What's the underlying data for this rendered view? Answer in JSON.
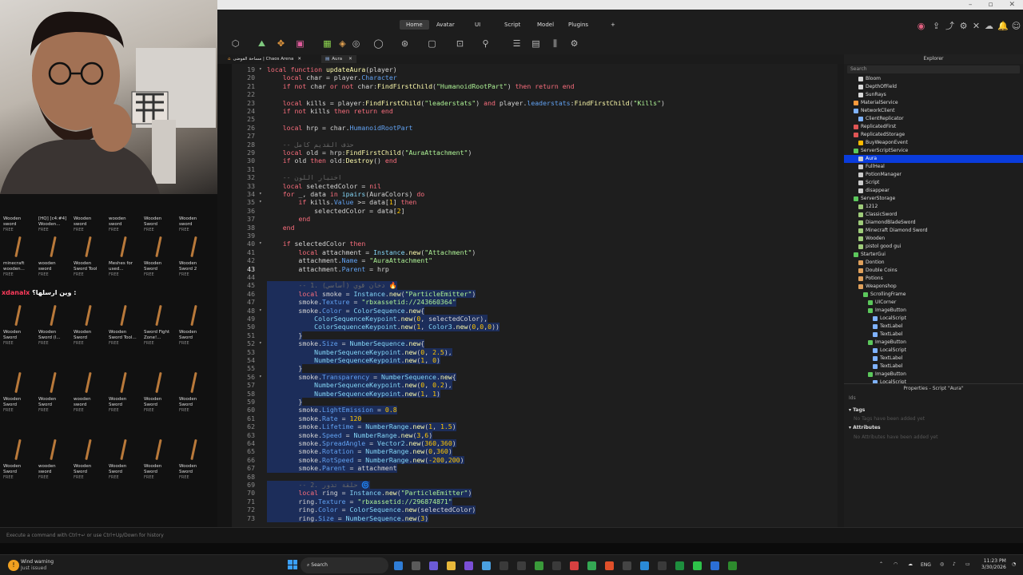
{
  "ribbon": {
    "tabs": [
      "Home",
      "Avatar",
      "UI",
      "Script",
      "Model",
      "Plugins"
    ],
    "add_tab": "+"
  },
  "doc_tabs": [
    "مساحة الفوضى | Chaos Arena",
    "Aura"
  ],
  "toolbox": {
    "rows": [
      [
        [
          "Wooden",
          "sword",
          "FREE"
        ],
        [
          "[HQ] [c4:#4]",
          "Wooden...",
          "FREE"
        ],
        [
          "Wooden",
          "sword",
          "FREE"
        ],
        [
          "wooden",
          "sword",
          "FREE"
        ],
        [
          "Wooden",
          "Sword",
          "FREE"
        ],
        [
          "Wooden",
          "sword",
          "FREE"
        ]
      ],
      [
        [
          "minecraft",
          "wooden...",
          "FREE"
        ],
        [
          "wooden",
          "sword",
          "FREE"
        ],
        [
          "Wooden",
          "Sword Tool",
          "FREE"
        ],
        [
          "Meshes for",
          "used...",
          "FREE"
        ],
        [
          "Wooden",
          "Sword",
          "FREE"
        ],
        [
          "Wooden",
          "Sword 2",
          "FREE"
        ]
      ],
      [
        [
          "Wooden",
          "Sword",
          "FREE"
        ],
        [
          "Wooden",
          "Sword (l...",
          "FREE"
        ],
        [
          "Wooden",
          "Sword",
          "FREE"
        ],
        [
          "Wooden",
          "Sword Tool...",
          "FREE"
        ],
        [
          "Sword Fight",
          "Zone!...",
          "FREE"
        ],
        [
          "Wooden",
          "Sword",
          "FREE"
        ]
      ],
      [
        [
          "Wooden",
          "Sword",
          "FREE"
        ],
        [
          "Wooden",
          "Sword",
          "FREE"
        ],
        [
          "wooden",
          "sword",
          "FREE"
        ],
        [
          "Wooden",
          "Sword",
          "FREE"
        ],
        [
          "Wooden",
          "Sword",
          "FREE"
        ],
        [
          "Wooden",
          "Sword",
          "FREE"
        ]
      ],
      [
        [
          "Wooden",
          "Sword",
          "FREE"
        ],
        [
          "wooden",
          "sword",
          "FREE"
        ],
        [
          "Wooden",
          "Sword",
          "FREE"
        ],
        [
          "Wooden",
          "Sword",
          "FREE"
        ],
        [
          "Wooden",
          "Sword",
          "FREE"
        ],
        [
          "Wooden",
          "Sword",
          "FREE"
        ]
      ]
    ]
  },
  "chat_overlay": {
    "user": "xdanalx",
    "message": "وين ارسلها؟ :"
  },
  "editor": {
    "lines": [
      {
        "n": "19",
        "fold": "▾",
        "sel": false,
        "html": "<span class='kw'>local function</span> <span class='fn'>updateAura</span>(player)"
      },
      {
        "n": "20",
        "sel": false,
        "html": "    <span class='kw'>local</span> char = player.<span class='prop'>Character</span>"
      },
      {
        "n": "21",
        "sel": false,
        "html": "    <span class='kw'>if not</span> char <span class='kw'>or not</span> char:<span class='fn'>FindFirstChild</span>(<span class='str'>\"HumanoidRootPart\"</span>) <span class='kw'>then return end</span>"
      },
      {
        "n": "22",
        "sel": false,
        "html": ""
      },
      {
        "n": "23",
        "sel": false,
        "html": "    <span class='kw'>local</span> kills = player:<span class='fn'>FindFirstChild</span>(<span class='str'>\"leaderstats\"</span>) <span class='kw'>and</span> player.<span class='prop'>leaderstats</span>:<span class='fn'>FindFirstChild</span>(<span class='str'>\"Kills\"</span>)"
      },
      {
        "n": "24",
        "sel": false,
        "html": "    <span class='kw'>if not</span> kills <span class='kw'>then return end</span>"
      },
      {
        "n": "25",
        "sel": false,
        "html": ""
      },
      {
        "n": "26",
        "sel": false,
        "html": "    <span class='kw'>local</span> hrp = char.<span class='prop'>HumanoidRootPart</span>"
      },
      {
        "n": "27",
        "sel": false,
        "html": ""
      },
      {
        "n": "28",
        "sel": false,
        "html": "    <span class='cm'>-- حذف القديم كامل</span>"
      },
      {
        "n": "29",
        "sel": false,
        "html": "    <span class='kw'>local</span> old = hrp:<span class='fn'>FindFirstChild</span>(<span class='str'>\"AuraAttachment\"</span>)"
      },
      {
        "n": "30",
        "sel": false,
        "html": "    <span class='kw'>if</span> old <span class='kw'>then</span> old:<span class='fn'>Destroy</span>() <span class='kw'>end</span>"
      },
      {
        "n": "31",
        "sel": false,
        "html": ""
      },
      {
        "n": "32",
        "sel": false,
        "html": "    <span class='cm'>-- اختيار اللون</span>"
      },
      {
        "n": "33",
        "sel": false,
        "html": "    <span class='kw'>local</span> selectedColor = <span class='kw'>nil</span>"
      },
      {
        "n": "34",
        "fold": "▾",
        "sel": false,
        "html": "    <span class='kw'>for</span> _, data <span class='kw'>in</span> <span class='bi'>ipairs</span>(AuraColors) <span class='kw'>do</span>"
      },
      {
        "n": "35",
        "fold": "▾",
        "sel": false,
        "html": "        <span class='kw'>if</span> kills.<span class='prop'>Value</span> &gt;= data[<span class='num'>1</span>] <span class='kw'>then</span>"
      },
      {
        "n": "36",
        "sel": false,
        "html": "            selectedColor = data[<span class='num'>2</span>]"
      },
      {
        "n": "37",
        "sel": false,
        "html": "        <span class='kw'>end</span>"
      },
      {
        "n": "38",
        "sel": false,
        "html": "    <span class='kw'>end</span>"
      },
      {
        "n": "39",
        "sel": false,
        "html": ""
      },
      {
        "n": "40",
        "fold": "▾",
        "sel": false,
        "html": "    <span class='kw'>if</span> selectedColor <span class='kw'>then</span>"
      },
      {
        "n": "41",
        "sel": false,
        "html": "        <span class='kw'>local</span> attachment = <span class='bi'>Instance</span>.<span class='fn'>new</span>(<span class='str'>\"Attachment\"</span>)"
      },
      {
        "n": "42",
        "sel": false,
        "html": "        attachment.<span class='prop'>Name</span> = <span class='str'>\"AuraAttachment\"</span>"
      },
      {
        "n": "43",
        "cur": true,
        "sel": false,
        "html": "        attachment.<span class='prop'>Parent</span> = hrp"
      },
      {
        "n": "44",
        "sel": false,
        "html": ""
      },
      {
        "n": "45",
        "sel": true,
        "html": "        <span class='cm'>-- 1. دخان قوي (أساسي) 🔥</span>"
      },
      {
        "n": "46",
        "sel": true,
        "html": "        <span class='kw'>local</span> smoke = <span class='bi'>Instance</span>.<span class='fn'>new</span>(<span class='str'>\"ParticleEmitter\"</span>)"
      },
      {
        "n": "47",
        "sel": true,
        "html": "        smoke.<span class='prop'>Texture</span> = <span class='str'>\"rbxassetid://243660364\"</span>"
      },
      {
        "n": "48",
        "fold": "▾",
        "sel": true,
        "html": "        smoke.<span class='prop'>Color</span> = <span class='bi'>ColorSequence</span>.<span class='fn'>new</span>{"
      },
      {
        "n": "49",
        "sel": true,
        "html": "            <span class='bi'>ColorSequenceKeypoint</span>.<span class='fn'>new</span>(<span class='num'>0</span>, selectedColor),"
      },
      {
        "n": "50",
        "sel": true,
        "html": "            <span class='bi'>ColorSequenceKeypoint</span>.<span class='fn'>new</span>(<span class='num'>1</span>, <span class='bi'>Color3</span>.<span class='fn'>new</span>(<span class='num'>0</span>,<span class='num'>0</span>,<span class='num'>0</span>))"
      },
      {
        "n": "51",
        "sel": true,
        "html": "        }"
      },
      {
        "n": "52",
        "fold": "▾",
        "sel": true,
        "html": "        smoke.<span class='prop'>Size</span> = <span class='bi'>NumberSequence</span>.<span class='fn'>new</span>{"
      },
      {
        "n": "53",
        "sel": true,
        "html": "            <span class='bi'>NumberSequenceKeypoint</span>.<span class='fn'>new</span>(<span class='num'>0</span>, <span class='num'>2.5</span>),"
      },
      {
        "n": "54",
        "sel": true,
        "html": "            <span class='bi'>NumberSequenceKeypoint</span>.<span class='fn'>new</span>(<span class='num'>1</span>, <span class='num'>0</span>)"
      },
      {
        "n": "55",
        "sel": true,
        "html": "        }"
      },
      {
        "n": "56",
        "fold": "▾",
        "sel": true,
        "html": "        smoke.<span class='prop'>Transparency</span> = <span class='bi'>NumberSequence</span>.<span class='fn'>new</span>{"
      },
      {
        "n": "57",
        "sel": true,
        "html": "            <span class='bi'>NumberSequenceKeypoint</span>.<span class='fn'>new</span>(<span class='num'>0</span>, <span class='num'>0.2</span>),"
      },
      {
        "n": "58",
        "sel": true,
        "html": "            <span class='bi'>NumberSequenceKeypoint</span>.<span class='fn'>new</span>(<span class='num'>1</span>, <span class='num'>1</span>)"
      },
      {
        "n": "59",
        "sel": true,
        "html": "        }"
      },
      {
        "n": "60",
        "sel": true,
        "html": "        smoke.<span class='prop'>LightEmission</span> = <span class='num'>0.8</span>"
      },
      {
        "n": "61",
        "sel": true,
        "html": "        smoke.<span class='prop'>Rate</span> = <span class='num'>120</span>"
      },
      {
        "n": "62",
        "sel": true,
        "html": "        smoke.<span class='prop'>Lifetime</span> = <span class='bi'>NumberRange</span>.<span class='fn'>new</span>(<span class='num'>1</span>, <span class='num'>1.5</span>)"
      },
      {
        "n": "63",
        "sel": true,
        "html": "        smoke.<span class='prop'>Speed</span> = <span class='bi'>NumberRange</span>.<span class='fn'>new</span>(<span class='num'>3</span>,<span class='num'>6</span>)"
      },
      {
        "n": "64",
        "sel": true,
        "html": "        smoke.<span class='prop'>SpreadAngle</span> = <span class='bi'>Vector2</span>.<span class='fn'>new</span>(<span class='num'>360</span>,<span class='num'>360</span>)"
      },
      {
        "n": "65",
        "sel": true,
        "html": "        smoke.<span class='prop'>Rotation</span> = <span class='bi'>NumberRange</span>.<span class='fn'>new</span>(<span class='num'>0</span>,<span class='num'>360</span>)"
      },
      {
        "n": "66",
        "sel": true,
        "html": "        smoke.<span class='prop'>RotSpeed</span> = <span class='bi'>NumberRange</span>.<span class='fn'>new</span>(<span class='num'>-200</span>,<span class='num'>200</span>)"
      },
      {
        "n": "67",
        "sel": true,
        "html": "        smoke.<span class='prop'>Parent</span> = attachment"
      },
      {
        "n": "68",
        "sel": true,
        "html": ""
      },
      {
        "n": "69",
        "sel": true,
        "html": "        <span class='cm'>-- 2. حلقة تدور 🌀</span>"
      },
      {
        "n": "70",
        "sel": true,
        "html": "        <span class='kw'>local</span> ring = <span class='bi'>Instance</span>.<span class='fn'>new</span>(<span class='str'>\"ParticleEmitter\"</span>)"
      },
      {
        "n": "71",
        "sel": true,
        "html": "        ring.<span class='prop'>Texture</span> = <span class='str'>\"rbxassetid://296874871\"</span>"
      },
      {
        "n": "72",
        "sel": true,
        "html": "        ring.<span class='prop'>Color</span> = <span class='bi'>ColorSequence</span>.<span class='fn'>new</span>(selectedColor)"
      },
      {
        "n": "73",
        "sel": true,
        "html": "        ring.<span class='prop'>Size</span> = <span class='bi'>NumberSequence</span>.<span class='fn'>new</span>(<span class='num'>3</span>)"
      }
    ]
  },
  "explorer": {
    "title": "Explorer",
    "search_placeholder": "Search",
    "items": [
      {
        "label": "Bloom",
        "indent": 2,
        "color": "#d9d9d9"
      },
      {
        "label": "DepthOfField",
        "indent": 2,
        "color": "#d9d9d9"
      },
      {
        "label": "SunRays",
        "indent": 2,
        "color": "#d9d9d9"
      },
      {
        "label": "MaterialService",
        "indent": 1,
        "color": "#ff9a3c"
      },
      {
        "label": "NetworkClient",
        "indent": 1,
        "color": "#7fb2ff"
      },
      {
        "label": "ClientReplicator",
        "indent": 2,
        "color": "#7fb2ff"
      },
      {
        "label": "ReplicatedFirst",
        "indent": 1,
        "color": "#e05555"
      },
      {
        "label": "ReplicatedStorage",
        "indent": 1,
        "color": "#e05555"
      },
      {
        "label": "BuyWeaponEvent",
        "indent": 2,
        "color": "#ffbb00"
      },
      {
        "label": "ServerScriptService",
        "indent": 1,
        "color": "#5cc85c"
      },
      {
        "label": "Aura",
        "indent": 2,
        "color": "#cccccc",
        "sel": true
      },
      {
        "label": "FullHeal",
        "indent": 2,
        "color": "#cccccc"
      },
      {
        "label": "PotionManager",
        "indent": 2,
        "color": "#cccccc"
      },
      {
        "label": "Script",
        "indent": 2,
        "color": "#cccccc"
      },
      {
        "label": "disappear",
        "indent": 2,
        "color": "#cccccc"
      },
      {
        "label": "ServerStorage",
        "indent": 1,
        "color": "#5cc85c"
      },
      {
        "label": "1212",
        "indent": 2,
        "color": "#9fcc7a"
      },
      {
        "label": "ClassicSword",
        "indent": 2,
        "color": "#9fcc7a"
      },
      {
        "label": "DiamondBladeSword",
        "indent": 2,
        "color": "#9fcc7a"
      },
      {
        "label": "Minecraft Diamond Sword",
        "indent": 2,
        "color": "#9fcc7a"
      },
      {
        "label": "Wooden",
        "indent": 2,
        "color": "#9fcc7a"
      },
      {
        "label": "pistol good gui",
        "indent": 2,
        "color": "#9fcc7a"
      },
      {
        "label": "StarterGui",
        "indent": 1,
        "color": "#5cc85c"
      },
      {
        "label": "Dontion",
        "indent": 2,
        "color": "#e0a15c"
      },
      {
        "label": "Double Coins",
        "indent": 2,
        "color": "#e0a15c"
      },
      {
        "label": "Potions",
        "indent": 2,
        "color": "#e0a15c"
      },
      {
        "label": "Weaponshop",
        "indent": 2,
        "color": "#e0a15c"
      },
      {
        "label": "ScrollingFrame",
        "indent": 3,
        "color": "#5cc85c"
      },
      {
        "label": "UICorner",
        "indent": 4,
        "color": "#5cc85c"
      },
      {
        "label": "ImageButton",
        "indent": 4,
        "color": "#5cc85c"
      },
      {
        "label": "LocalScript",
        "indent": 5,
        "color": "#7fb2ff"
      },
      {
        "label": "TextLabel",
        "indent": 5,
        "color": "#7fb2ff"
      },
      {
        "label": "TextLabel",
        "indent": 5,
        "color": "#7fb2ff"
      },
      {
        "label": "ImageButton",
        "indent": 4,
        "color": "#5cc85c"
      },
      {
        "label": "LocalScript",
        "indent": 5,
        "color": "#7fb2ff"
      },
      {
        "label": "TextLabel",
        "indent": 5,
        "color": "#7fb2ff"
      },
      {
        "label": "TextLabel",
        "indent": 5,
        "color": "#7fb2ff"
      },
      {
        "label": "ImageButton",
        "indent": 4,
        "color": "#5cc85c"
      },
      {
        "label": "LocalScript",
        "indent": 5,
        "color": "#7fb2ff"
      }
    ]
  },
  "properties": {
    "title": "Properties - Script \"Aura\"",
    "filter": "Ids",
    "tags_header": "Tags",
    "tags_empty": "No Tags have been added yet",
    "attributes_header": "Attributes",
    "attributes_empty": "No Attributes have been added yet"
  },
  "command_bar": {
    "placeholder": "Execute a command with Ctrl+↵ or use Ctrl+Up/Down for history"
  },
  "taskbar": {
    "weather_title": "Wind warning",
    "weather_sub": "Just issued",
    "search": "Search",
    "lang": "ENG",
    "time": "11:23 PM",
    "date": "3/30/2026"
  }
}
